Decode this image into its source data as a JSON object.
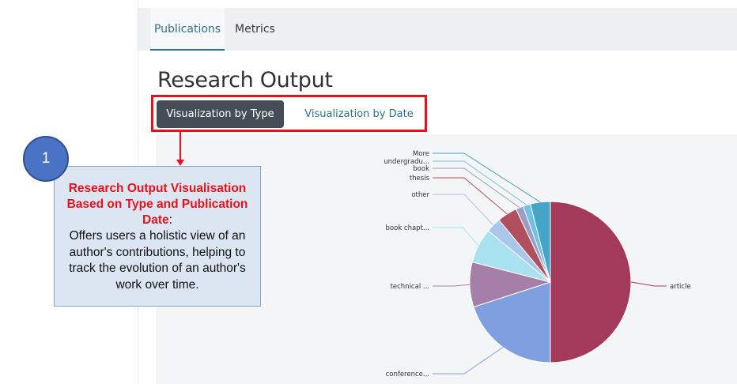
{
  "tabs": {
    "publications": "Publications",
    "metrics": "Metrics"
  },
  "page_title": "Research Output",
  "view_buttons": {
    "by_type": "Visualization by Type",
    "by_date": "Visualization by Date"
  },
  "annotation": {
    "badge_number": "1",
    "heading": "Research Output Visualisation Based on Type and Publication Date",
    "colon": ":",
    "body": "Offers users a holistic view of an author's contributions, helping to track the evolution of an author's work over time."
  },
  "colors": {
    "accent": "#2f6f8a",
    "highlight": "#e8101a",
    "active_button": "#454e56"
  },
  "chart_data": {
    "type": "pie",
    "title": "",
    "series": [
      {
        "label": "article",
        "value": 50,
        "color": "#a43a5a"
      },
      {
        "label": "conference...",
        "value": 20,
        "color": "#7f9fe0"
      },
      {
        "label": "technical ...",
        "value": 9,
        "color": "#a57fa8"
      },
      {
        "label": "book chapt...",
        "value": 7,
        "color": "#a8e2f1"
      },
      {
        "label": "other",
        "value": 3,
        "color": "#aac6e8"
      },
      {
        "label": "thesis",
        "value": 4,
        "color": "#b04f5d"
      },
      {
        "label": "book",
        "value": 1.5,
        "color": "#9e9bc6"
      },
      {
        "label": "undergradu...",
        "value": 1.5,
        "color": "#6fc3e0"
      },
      {
        "label": "More",
        "value": 4,
        "color": "#44a5c8"
      }
    ]
  }
}
